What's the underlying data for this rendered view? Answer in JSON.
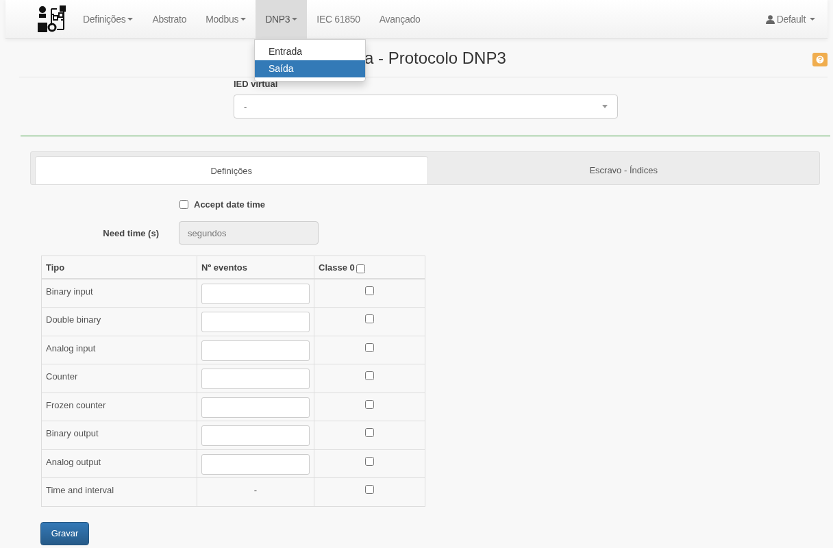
{
  "navbar": {
    "items": [
      {
        "label": "Definições",
        "dropdown": true,
        "selected": false
      },
      {
        "label": "Abstrato",
        "dropdown": false,
        "selected": false
      },
      {
        "label": "Modbus",
        "dropdown": true,
        "selected": false
      },
      {
        "label": "DNP3",
        "dropdown": true,
        "selected": true
      },
      {
        "label": "IEC 61850",
        "dropdown": false,
        "selected": false
      },
      {
        "label": "Avançado",
        "dropdown": false,
        "selected": false
      }
    ],
    "user": "Default"
  },
  "dropdown_menu": {
    "items": [
      {
        "label": "Entrada",
        "selected": false
      },
      {
        "label": "Saída",
        "selected": true
      }
    ]
  },
  "page_title": "a - Protocolo DNP3",
  "ied_virtual": {
    "label": "IED virtual",
    "value": "-"
  },
  "tabs": [
    {
      "label": "Definições",
      "selected": true
    },
    {
      "label": "Escravo - Índices",
      "selected": false
    }
  ],
  "accept_date_time": {
    "label": "Accept date time",
    "checked": false
  },
  "need_time": {
    "label": "Need time (s)",
    "placeholder": "segundos"
  },
  "table": {
    "columns": [
      "Tipo",
      "Nº eventos",
      "Classe 0"
    ],
    "header_checked": false,
    "rows": [
      {
        "tipo": "Binary input",
        "kind": "input",
        "checked": false
      },
      {
        "tipo": "Double binary",
        "kind": "input",
        "checked": false
      },
      {
        "tipo": "Analog input",
        "kind": "input",
        "checked": false
      },
      {
        "tipo": "Counter",
        "kind": "input",
        "checked": false
      },
      {
        "tipo": "Frozen counter",
        "kind": "input",
        "checked": false
      },
      {
        "tipo": "Binary output",
        "kind": "input",
        "checked": false
      },
      {
        "tipo": "Analog output",
        "kind": "input",
        "checked": false
      },
      {
        "tipo": "Time and interval",
        "kind": "text",
        "text": "-",
        "checked": false
      }
    ]
  },
  "save_button": "Gravar"
}
